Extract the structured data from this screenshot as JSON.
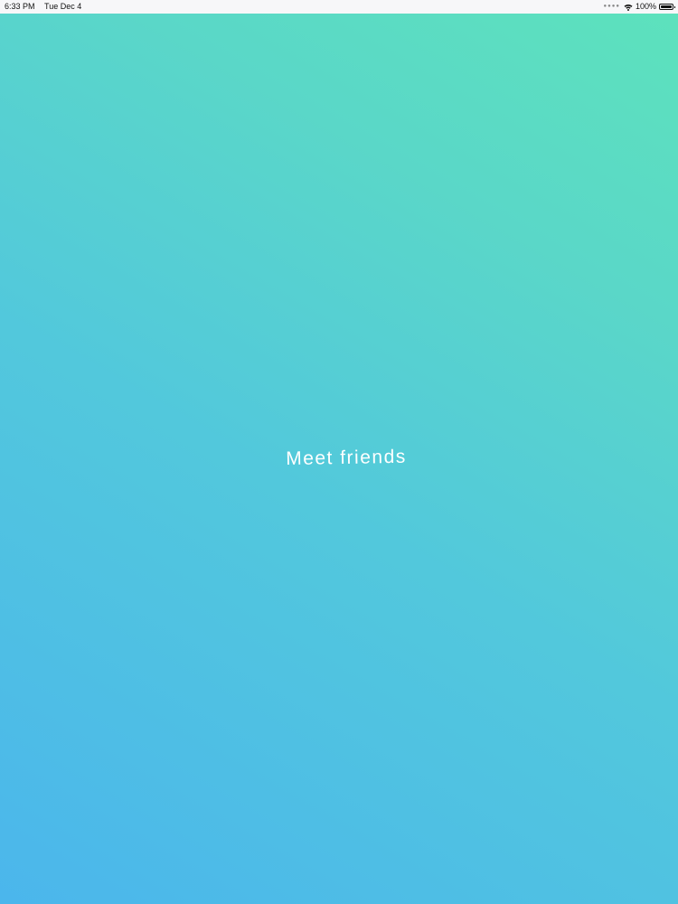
{
  "status_bar": {
    "time": "6:33 PM",
    "date": "Tue Dec 4",
    "signal_icon": "cellular-signal-icon",
    "wifi_icon": "wifi-icon",
    "battery_label": "100%",
    "battery_icon": "battery-icon",
    "battery_level": 1.0
  },
  "main": {
    "headline": "Meet friends"
  },
  "colors": {
    "gradient_start": "#4bb6ec",
    "gradient_end": "#5de2bc",
    "text": "#ffffff"
  }
}
